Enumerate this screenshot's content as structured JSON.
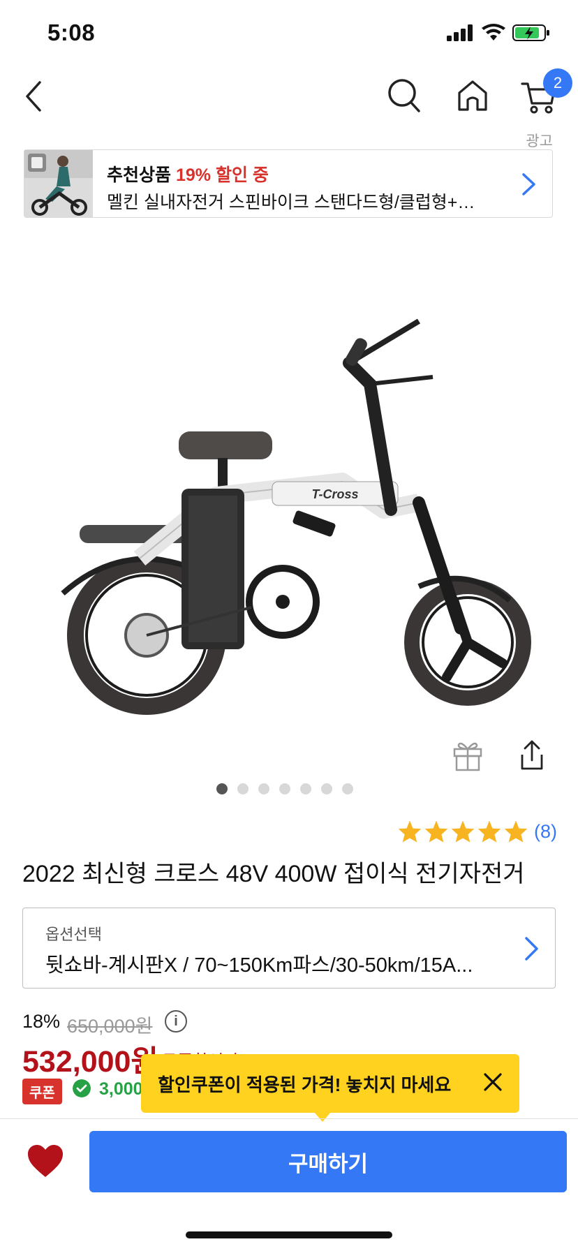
{
  "status_bar": {
    "time": "5:08"
  },
  "nav": {
    "cart_count": "2"
  },
  "ad": {
    "label": "광고",
    "title_prefix": "추천상품",
    "title_discount": "19% 할인 중",
    "subtitle": "멜킨 실내자전거 스핀바이크 스탠다드형/클럽형+…"
  },
  "gallery": {
    "total_images": 7,
    "active_index": 0,
    "hero_brand_text": "T-Cross"
  },
  "rating": {
    "stars": 5,
    "count": "(8)"
  },
  "product": {
    "title": "2022 최신형 크로스 48V 400W 접이식 전기자전거"
  },
  "option": {
    "label": "옵션선택",
    "value": "뒷쇼바-계시판X / 70~150Km파스/30-50km/15A..."
  },
  "price": {
    "discount_pct": "18%",
    "original": "650,000원",
    "current": "532,000원",
    "current_sub": "쿠폰할인가",
    "coupon_badge": "쿠폰",
    "coupon_amount": "3,000"
  },
  "tooltip": {
    "text": "할인쿠폰이 적용된 가격! 놓치지 마세요"
  },
  "bottom_bar": {
    "buy_label": "구매하기"
  },
  "colors": {
    "accent_blue": "#3478f6",
    "price_red": "#b3121a",
    "tooltip_yellow": "#ffd21f",
    "heart_red": "#b3121a"
  }
}
